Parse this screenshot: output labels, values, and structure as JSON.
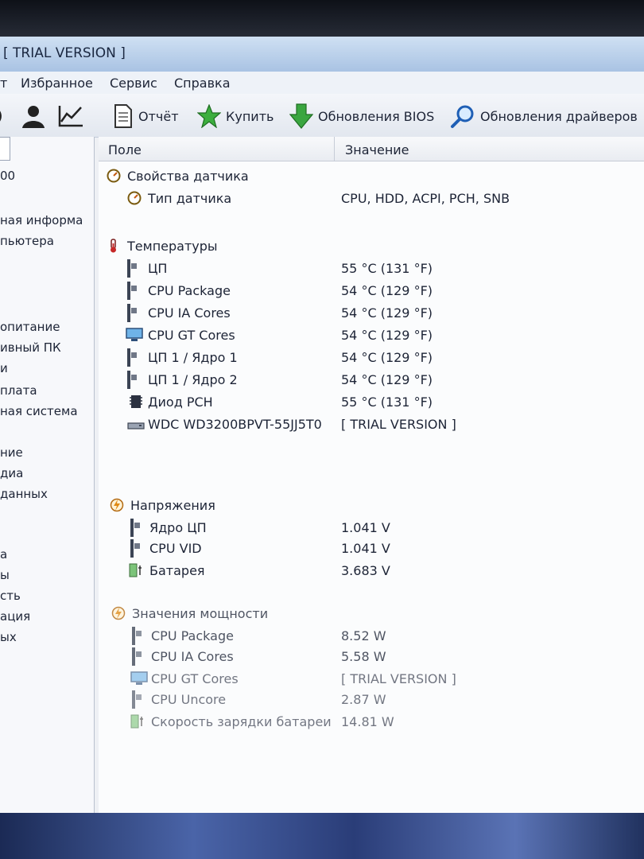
{
  "window": {
    "title": "[ TRIAL VERSION ]"
  },
  "menu": {
    "items": [
      "т",
      "Избранное",
      "Сервис",
      "Справка"
    ]
  },
  "toolbar": {
    "report": "Отчёт",
    "buy": "Купить",
    "bios_updates": "Обновления BIOS",
    "driver_updates": "Обновления драйверов"
  },
  "sidebar": {
    "items": [
      "00",
      "ная информа",
      "пьютера",
      "опитание",
      "ивный ПК",
      "и",
      "плата",
      "ная система",
      "ние",
      "диа",
      "данных",
      "а",
      "ы",
      "сть",
      "ация",
      "ых"
    ]
  },
  "columns": {
    "field": "Поле",
    "value": "Значение"
  },
  "sensor": {
    "group": "Свойства датчика",
    "type_label": "Тип датчика",
    "type_value": "CPU, HDD, ACPI, PCH, SNB"
  },
  "temperatures": {
    "group": "Температуры",
    "rows": [
      {
        "name": "ЦП",
        "value": "55 °C  (131 °F)"
      },
      {
        "name": "CPU Package",
        "value": "54 °C  (129 °F)"
      },
      {
        "name": "CPU IA Cores",
        "value": "54 °C  (129 °F)"
      },
      {
        "name": "CPU GT Cores",
        "value": "54 °C  (129 °F)"
      },
      {
        "name": "ЦП 1 / Ядро 1",
        "value": "54 °C  (129 °F)"
      },
      {
        "name": "ЦП 1 / Ядро 2",
        "value": "54 °C  (129 °F)"
      },
      {
        "name": "Диод PCH",
        "value": "55 °C  (131 °F)"
      },
      {
        "name": "WDC WD3200BPVT-55JJ5T0",
        "value": "[ TRIAL VERSION ]"
      }
    ]
  },
  "voltages": {
    "group": "Напряжения",
    "rows": [
      {
        "name": "Ядро ЦП",
        "value": "1.041 V"
      },
      {
        "name": "CPU VID",
        "value": "1.041 V"
      },
      {
        "name": "Батарея",
        "value": "3.683 V"
      }
    ]
  },
  "power": {
    "group": "Значения мощности",
    "rows": [
      {
        "name": "CPU Package",
        "value": "8.52 W"
      },
      {
        "name": "CPU IA Cores",
        "value": "5.58 W"
      },
      {
        "name": "CPU GT Cores",
        "value": "[ TRIAL VERSION ]"
      },
      {
        "name": "CPU Uncore",
        "value": "2.87 W"
      },
      {
        "name": "Скорость зарядки батареи",
        "value": "14.81 W"
      }
    ]
  },
  "colors": {
    "accent": "#2f8a3a",
    "link_blue": "#1f5fb5",
    "text": "#1d2436"
  }
}
